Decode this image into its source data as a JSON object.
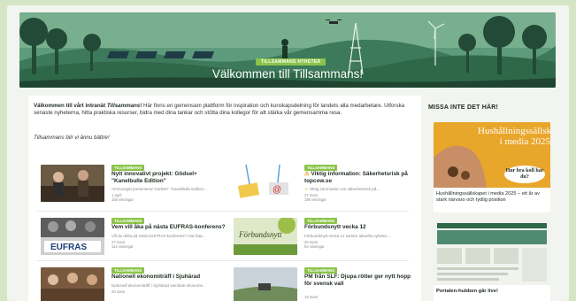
{
  "hero": {
    "badge": "TILLSAMMANS NYHETER",
    "title": "Välkommen till Tillsammans!"
  },
  "intro": {
    "lead_bold": "Välkommen till vårt intranät ",
    "lead_italic": "Tillsammans",
    "lead_bang": "!",
    "body": " Här finns en gemensam plattform för inspiration och kunskapsdelning för landets alla medarbetare. Utforska senaste nyheterna, hitta praktiska resurser, bidra med dina tankar och stötta dina kollegor för att stärka vår gemensamma resa.",
    "tagline": "Tillsammans blir vi ännu bättre!"
  },
  "news": [
    {
      "tag": "TILLSAMMANS",
      "title": "Nytt innovativt projekt: Gödsel+ \"Kanelbulle Edition\"",
      "summary": "Ammoniget presenterar Gödsel+ \"Kanelbulle Edition...",
      "date": "1 april",
      "views": "155 visningar"
    },
    {
      "tag": "TILLSAMMANS",
      "title": "Viktig information: Säkerhetsrisk på topcow.se",
      "summary": "Viktig information om säkerhetsrisk på...",
      "date": "27 mars",
      "views": "195 visningar",
      "warning": true
    },
    {
      "tag": "TILLSAMMANS",
      "title": "Vem vill åka på nästa EUFRAS-konferens?",
      "summary": "Vill du delta på nästa EUFRAS-konferens? Hat lista...",
      "date": "27 mars",
      "views": "114 visningar"
    },
    {
      "tag": "TILLSAMMANS",
      "title": "Förbundsnytt vecka 12",
      "summary": "Förbundsnytt vecka 12 samlar aktuella nyheter,...",
      "date": "20 mars",
      "views": "84 visningar"
    },
    {
      "tag": "TILLSAMMANS",
      "title": "Nationell ekonomiträff i Sjuhärad",
      "summary": "Nationell ekonomiträff i Sjuhärad samlade ekonome...",
      "date": "20 mars",
      "views": ""
    },
    {
      "tag": "TILLSAMMANS",
      "title": "PM från SLF: Djupa rötter ger nytt hopp för svensk vall",
      "summary": "",
      "date": "19 mars",
      "views": ""
    }
  ],
  "thumb_labels": {
    "eufras": "EUFRAS",
    "forbund": "Förbundsnytt"
  },
  "sidebar": {
    "heading": "MISSA INTE DET HÄR!",
    "promo1": {
      "image_text": "Hushållningssällskapet i media 2025",
      "image_badge": "Hur bra koll har du?",
      "caption": "Hushållningssällskapet i media 2025 – ett år av stark närvaro och tydlig position"
    },
    "promo2": {
      "caption": "Portalen-hubben går live!"
    }
  },
  "colors": {
    "accent": "#8bc34a",
    "background": "#d4e6c6",
    "warning": "#e0a000"
  }
}
